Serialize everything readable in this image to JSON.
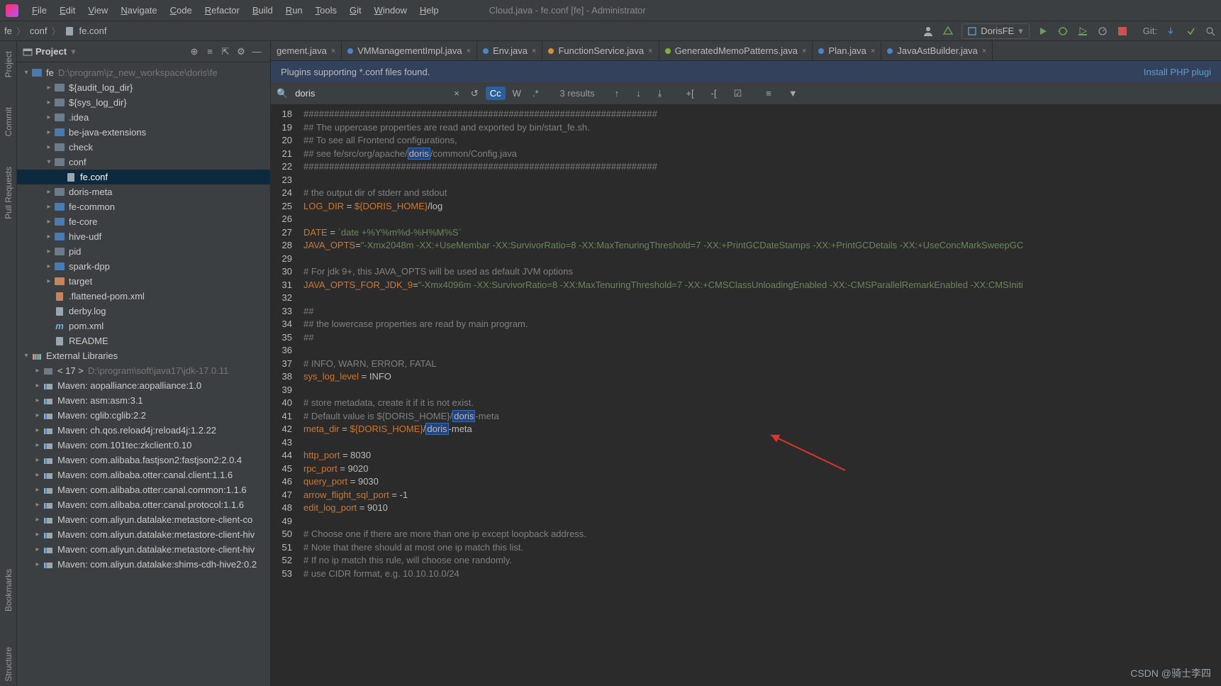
{
  "window_title": "Cloud.java - fe.conf [fe] - Administrator",
  "menu": [
    "File",
    "Edit",
    "View",
    "Navigate",
    "Code",
    "Refactor",
    "Build",
    "Run",
    "Tools",
    "Git",
    "Window",
    "Help"
  ],
  "breadcrumb": [
    "fe",
    "conf",
    "fe.conf"
  ],
  "run_config": "DorisFE",
  "git_label": "Git:",
  "sidebar": {
    "title": "Project",
    "root": {
      "name": "fe",
      "path": "D:\\program\\jz_new_workspace\\doris\\fe"
    },
    "items": [
      {
        "name": "${audit_log_dir}",
        "d": 2,
        "t": "f"
      },
      {
        "name": "${sys_log_dir}",
        "d": 2,
        "t": "f"
      },
      {
        "name": ".idea",
        "d": 2,
        "t": "f"
      },
      {
        "name": "be-java-extensions",
        "d": 2,
        "t": "m",
        "exp": true
      },
      {
        "name": "check",
        "d": 2,
        "t": "f"
      },
      {
        "name": "conf",
        "d": 2,
        "t": "f",
        "exp": true,
        "open": true
      },
      {
        "name": "fe.conf",
        "d": 3,
        "t": "file",
        "sel": true
      },
      {
        "name": "doris-meta",
        "d": 2,
        "t": "f"
      },
      {
        "name": "fe-common",
        "d": 2,
        "t": "m",
        "exp": true
      },
      {
        "name": "fe-core",
        "d": 2,
        "t": "m",
        "exp": true
      },
      {
        "name": "hive-udf",
        "d": 2,
        "t": "m",
        "exp": true
      },
      {
        "name": "pid",
        "d": 2,
        "t": "f"
      },
      {
        "name": "spark-dpp",
        "d": 2,
        "t": "m",
        "exp": true
      },
      {
        "name": "target",
        "d": 2,
        "t": "exc",
        "exp": true
      },
      {
        "name": ".flattened-pom.xml",
        "d": 2,
        "t": "xml"
      },
      {
        "name": "derby.log",
        "d": 2,
        "t": "log"
      },
      {
        "name": "pom.xml",
        "d": 2,
        "t": "pom"
      },
      {
        "name": "README",
        "d": 2,
        "t": "txt"
      }
    ],
    "ext_lib": "External Libraries",
    "jdk": {
      "name": "< 17 >",
      "path": "D:\\program\\soft\\java17\\jdk-17.0.11"
    },
    "libs": [
      "Maven: aopalliance:aopalliance:1.0",
      "Maven: asm:asm:3.1",
      "Maven: cglib:cglib:2.2",
      "Maven: ch.qos.reload4j:reload4j:1.2.22",
      "Maven: com.101tec:zkclient:0.10",
      "Maven: com.alibaba.fastjson2:fastjson2:2.0.4",
      "Maven: com.alibaba.otter:canal.client:1.1.6",
      "Maven: com.alibaba.otter:canal.common:1.1.6",
      "Maven: com.alibaba.otter:canal.protocol:1.1.6",
      "Maven: com.aliyun.datalake:metastore-client-co",
      "Maven: com.aliyun.datalake:metastore-client-hiv",
      "Maven: com.aliyun.datalake:metastore-client-hiv",
      "Maven: com.aliyun.datalake:shims-cdh-hive2:0.2"
    ]
  },
  "tabs": [
    {
      "label": "gement.java",
      "color": ""
    },
    {
      "label": "VMManagementImpl.java",
      "color": "#4a86c7"
    },
    {
      "label": "Env.java",
      "color": "#4a86c7"
    },
    {
      "label": "FunctionService.java",
      "color": "#d08f3b"
    },
    {
      "label": "GeneratedMemoPatterns.java",
      "color": "#7cb342"
    },
    {
      "label": "Plan.java",
      "color": "#4a86c7"
    },
    {
      "label": "JavaAstBuilder.java",
      "color": "#4a86c7"
    }
  ],
  "banner": {
    "msg": "Plugins supporting *.conf files found.",
    "link": "Install PHP plugi"
  },
  "find": {
    "query": "doris",
    "results": "3 results",
    "cc": "Cc",
    "w": "W"
  },
  "gutter_tabs": [
    "Project",
    "Commit",
    "Pull Requests",
    "Bookmarks",
    "Structure"
  ],
  "code": {
    "start": 18,
    "lines": [
      {
        "t": "#####################################################################",
        "cls": "c-cm"
      },
      {
        "t": "## The uppercase properties are read and exported by bin/start_fe.sh.",
        "cls": "c-cm"
      },
      {
        "t": "## To see all Frontend configurations,",
        "cls": "c-cm"
      },
      {
        "html": "<span class='c-cm'>## see fe/src/org/apache/</span><span class='c-hl'>doris</span><span class='c-cm'>/common/Config.java</span>"
      },
      {
        "t": "#####################################################################",
        "cls": "c-cm"
      },
      {
        "t": ""
      },
      {
        "t": "# the output dir of stderr and stdout",
        "cls": "c-cm"
      },
      {
        "html": "<span class='c-k'>LOG_DIR</span> = <span class='c-k'>${DORIS_HOME}</span>/log"
      },
      {
        "t": ""
      },
      {
        "html": "<span class='c-k'>DATE</span> = <span class='c-s'>`date +%Y%m%d-%H%M%S`</span>"
      },
      {
        "html": "<span class='c-k'>JAVA_OPTS</span>=<span class='c-s'>\"-Xmx2048m -XX:+UseMembar -XX:SurvivorRatio=8 -XX:MaxTenuringThreshold=7 -XX:+PrintGCDateStamps -XX:+PrintGCDetails -XX:+UseConcMarkSweepGC</span>"
      },
      {
        "t": ""
      },
      {
        "t": "# For jdk 9+, this JAVA_OPTS will be used as default JVM options",
        "cls": "c-cm"
      },
      {
        "html": "<span class='c-k'>JAVA_OPTS_FOR_JDK_9</span>=<span class='c-s'>\"-Xmx4096m -XX:SurvivorRatio=8 -XX:MaxTenuringThreshold=7 -XX:+CMSClassUnloadingEnabled -XX:-CMSParallelRemarkEnabled -XX:CMSIniti</span>"
      },
      {
        "t": ""
      },
      {
        "t": "##",
        "cls": "c-cm"
      },
      {
        "t": "## the lowercase properties are read by main program.",
        "cls": "c-cm"
      },
      {
        "t": "##",
        "cls": "c-cm"
      },
      {
        "t": ""
      },
      {
        "t": "# INFO, WARN, ERROR, FATAL",
        "cls": "c-cm"
      },
      {
        "html": "<span class='c-k'>sys_log_level</span> = INFO"
      },
      {
        "t": ""
      },
      {
        "t": "# store metadata, create it if it is not exist.",
        "cls": "c-cm"
      },
      {
        "html": "<span class='c-cm'># Default value is ${DORIS_HOME}/</span><span class='c-hl'>doris</span><span class='c-cm'>-meta</span>"
      },
      {
        "html": "<span class='c-k'>meta_dir</span> = <span class='c-k'>${DORIS_HOME}</span>/<span class='c-hl'>doris</span>-meta"
      },
      {
        "t": ""
      },
      {
        "html": "<span class='c-k'>http_port</span> = 8030"
      },
      {
        "html": "<span class='c-k'>rpc_port</span> = 9020"
      },
      {
        "html": "<span class='c-k'>query_port</span> = 9030"
      },
      {
        "html": "<span class='c-k'>arrow_flight_sql_port</span> = -1"
      },
      {
        "html": "<span class='c-k'>edit_log_port</span> = 9010"
      },
      {
        "t": ""
      },
      {
        "t": "# Choose one if there are more than one ip except loopback address.",
        "cls": "c-cm"
      },
      {
        "t": "# Note that there should at most one ip match this list.",
        "cls": "c-cm"
      },
      {
        "t": "# If no ip match this rule, will choose one randomly.",
        "cls": "c-cm"
      },
      {
        "t": "# use CIDR format, e.g. 10.10.10.0/24",
        "cls": "c-cm"
      }
    ]
  },
  "watermark": "CSDN @骑士李四"
}
